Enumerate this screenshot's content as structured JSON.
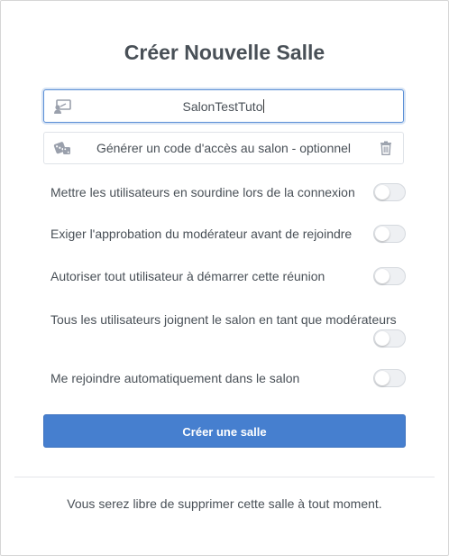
{
  "dialog": {
    "title": "Créer Nouvelle Salle"
  },
  "room_name_input": {
    "value": "SalonTestTuto",
    "icon": "room-sign-icon",
    "focused": true
  },
  "access_code": {
    "label": "Générer un code d'accès au salon - optionnel",
    "icon": "dice-icon",
    "delete_icon": "trash-icon"
  },
  "options": [
    {
      "label": "Mettre les utilisateurs en sourdine lors de la connexion",
      "enabled": false
    },
    {
      "label": "Exiger l'approbation du modérateur avant de rejoindre",
      "enabled": false
    },
    {
      "label": "Autoriser tout utilisateur à démarrer cette réunion",
      "enabled": false
    },
    {
      "label": "Tous les utilisateurs joignent le salon en tant que modérateurs",
      "enabled": false
    },
    {
      "label": "Me rejoindre automatiquement dans le salon",
      "enabled": false
    }
  ],
  "submit": {
    "label": "Créer une salle"
  },
  "footer": {
    "note": "Vous serez libre de supprimer cette salle à tout moment."
  },
  "colors": {
    "primary": "#467fcf",
    "text": "#495057",
    "focus_border": "#5b8fd6",
    "toggle_off": "#eef0f3"
  }
}
